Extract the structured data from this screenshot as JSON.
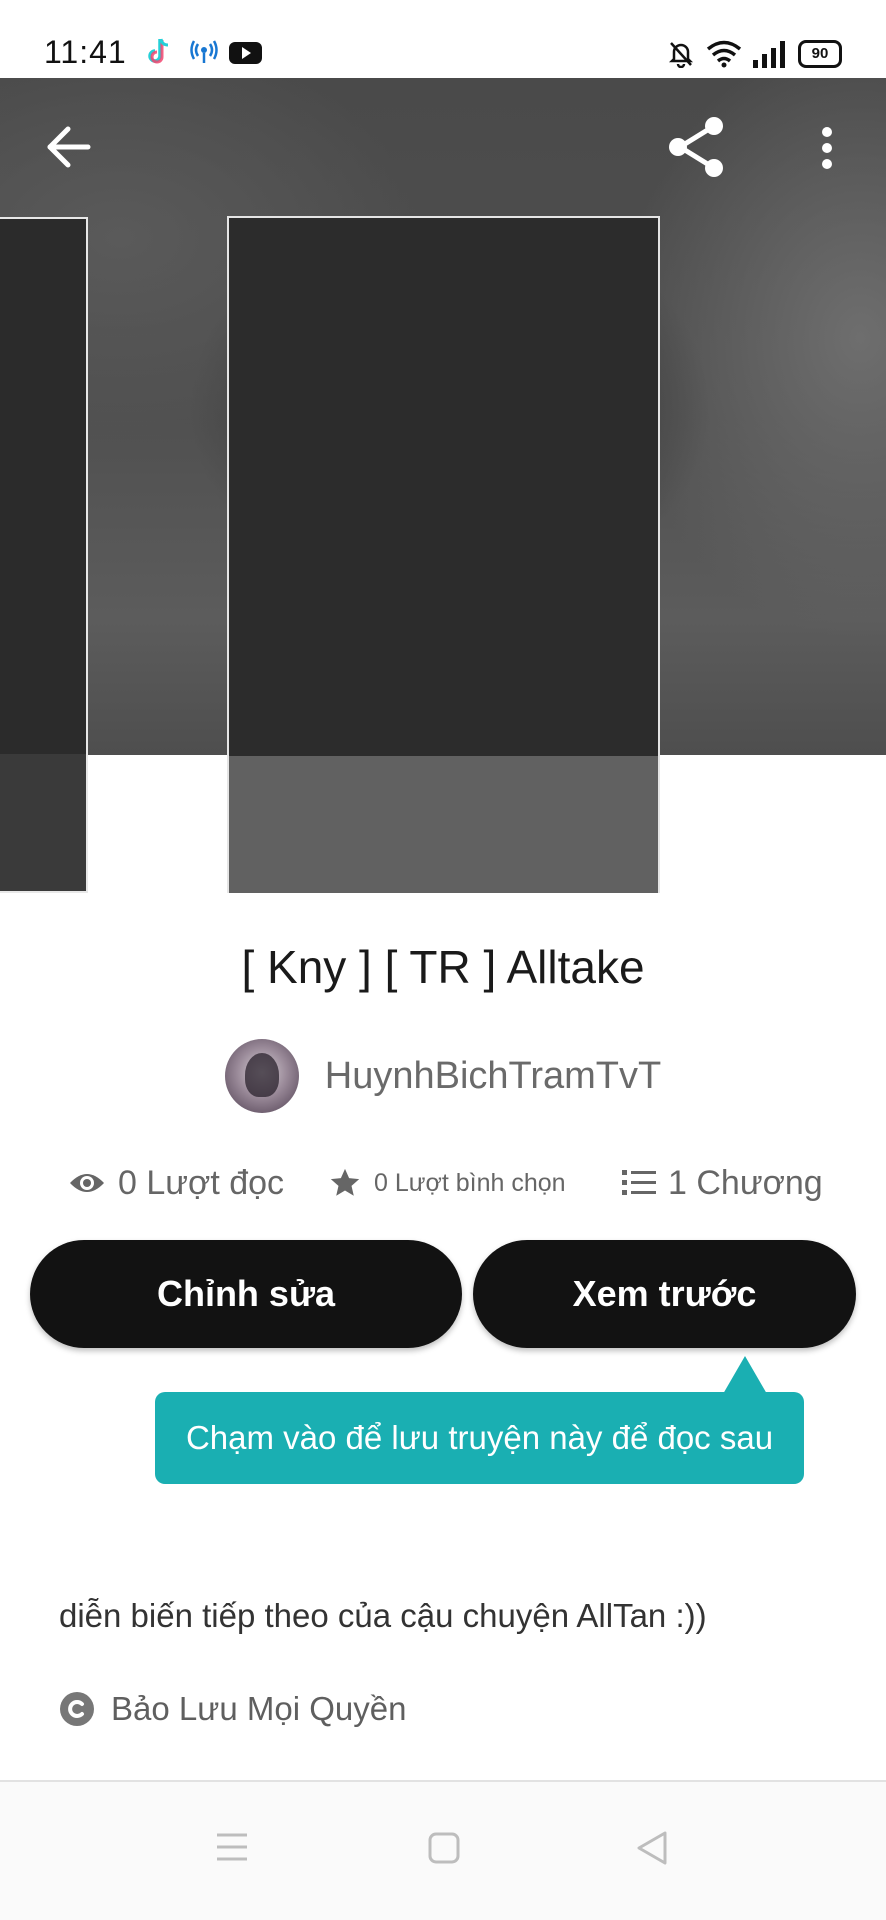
{
  "status_bar": {
    "time": "11:41",
    "battery": "90",
    "icons": [
      "tiktok-icon",
      "hotspot-icon",
      "youtube-icon",
      "bell-off-icon",
      "wifi-icon",
      "signal-icon",
      "battery-icon"
    ]
  },
  "toolbar": {
    "icons": [
      "back-arrow-icon",
      "share-icon",
      "more-vertical-icon"
    ]
  },
  "story": {
    "title": "[ Kny ] [ TR ] Alltake",
    "author": "HuynhBichTramTvT",
    "stats": {
      "reads": "0 Lượt đọc",
      "votes": "0 Lượt bình chọn",
      "parts": "1 Chương"
    },
    "description": "diễn biến tiếp theo của cậu chuyện AllTan :))",
    "copyright": "Bảo Lưu Mọi Quyền"
  },
  "actions": {
    "edit_label": "Chỉnh sửa",
    "preview_label": "Xem trước"
  },
  "tooltip": {
    "text": "Chạm vào để lưu truyện này để đọc sau"
  },
  "nav": {
    "icons": [
      "menu-icon",
      "home-square-icon",
      "back-triangle-icon"
    ]
  },
  "colors": {
    "accent_teal": "#1aafb2",
    "button_dark": "#121212"
  }
}
